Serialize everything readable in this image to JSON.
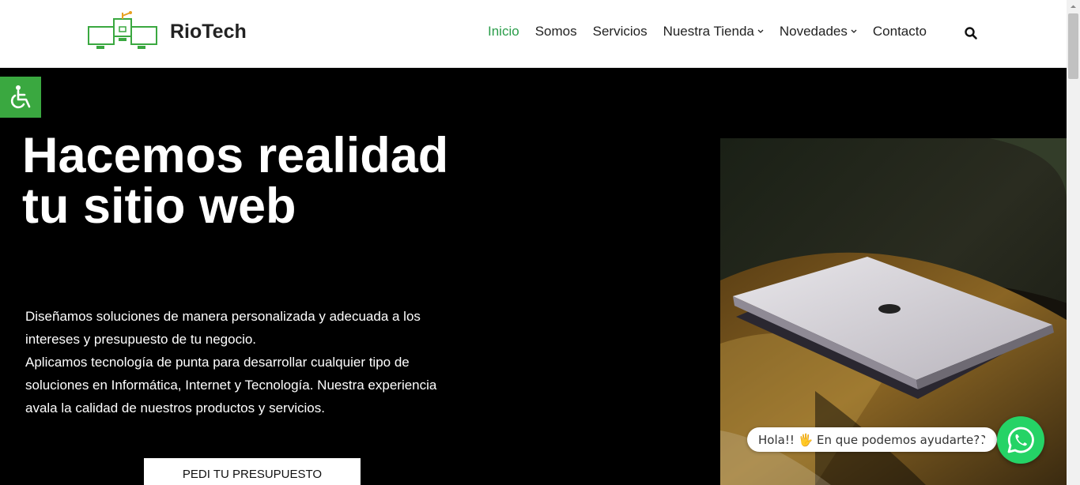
{
  "brand": {
    "name": "RioTech"
  },
  "nav": {
    "items": [
      {
        "label": "Inicio",
        "active": true,
        "dropdown": false
      },
      {
        "label": "Somos",
        "active": false,
        "dropdown": false
      },
      {
        "label": "Servicios",
        "active": false,
        "dropdown": false
      },
      {
        "label": "Nuestra Tienda",
        "active": false,
        "dropdown": true
      },
      {
        "label": "Novedades",
        "active": false,
        "dropdown": true
      },
      {
        "label": "Contacto",
        "active": false,
        "dropdown": false
      }
    ],
    "caret": "⌄",
    "active_color": "#2a9d4a",
    "search_icon": "search-icon"
  },
  "accessibility": {
    "icon": "wheelchair-icon",
    "color": "#3aa840"
  },
  "hero": {
    "title": "Hacemos realidad tu sitio web",
    "paragraph_1": "Diseñamos soluciones de manera personalizada y adecuada a los intereses y presupuesto de tu negocio.",
    "paragraph_2": "Aplicamos tecnología de punta para desarrollar cualquier tipo de soluciones en Informática, Internet y Tecnología. Nuestra experiencia avala la calidad de nuestros productos y servicios.",
    "cta_label": "PEDI TU PRESUPUESTO"
  },
  "chat": {
    "message": "Hola!! 🖐 En que podemos ayudarte??",
    "icon": "whatsapp-icon",
    "color": "#25d366"
  }
}
